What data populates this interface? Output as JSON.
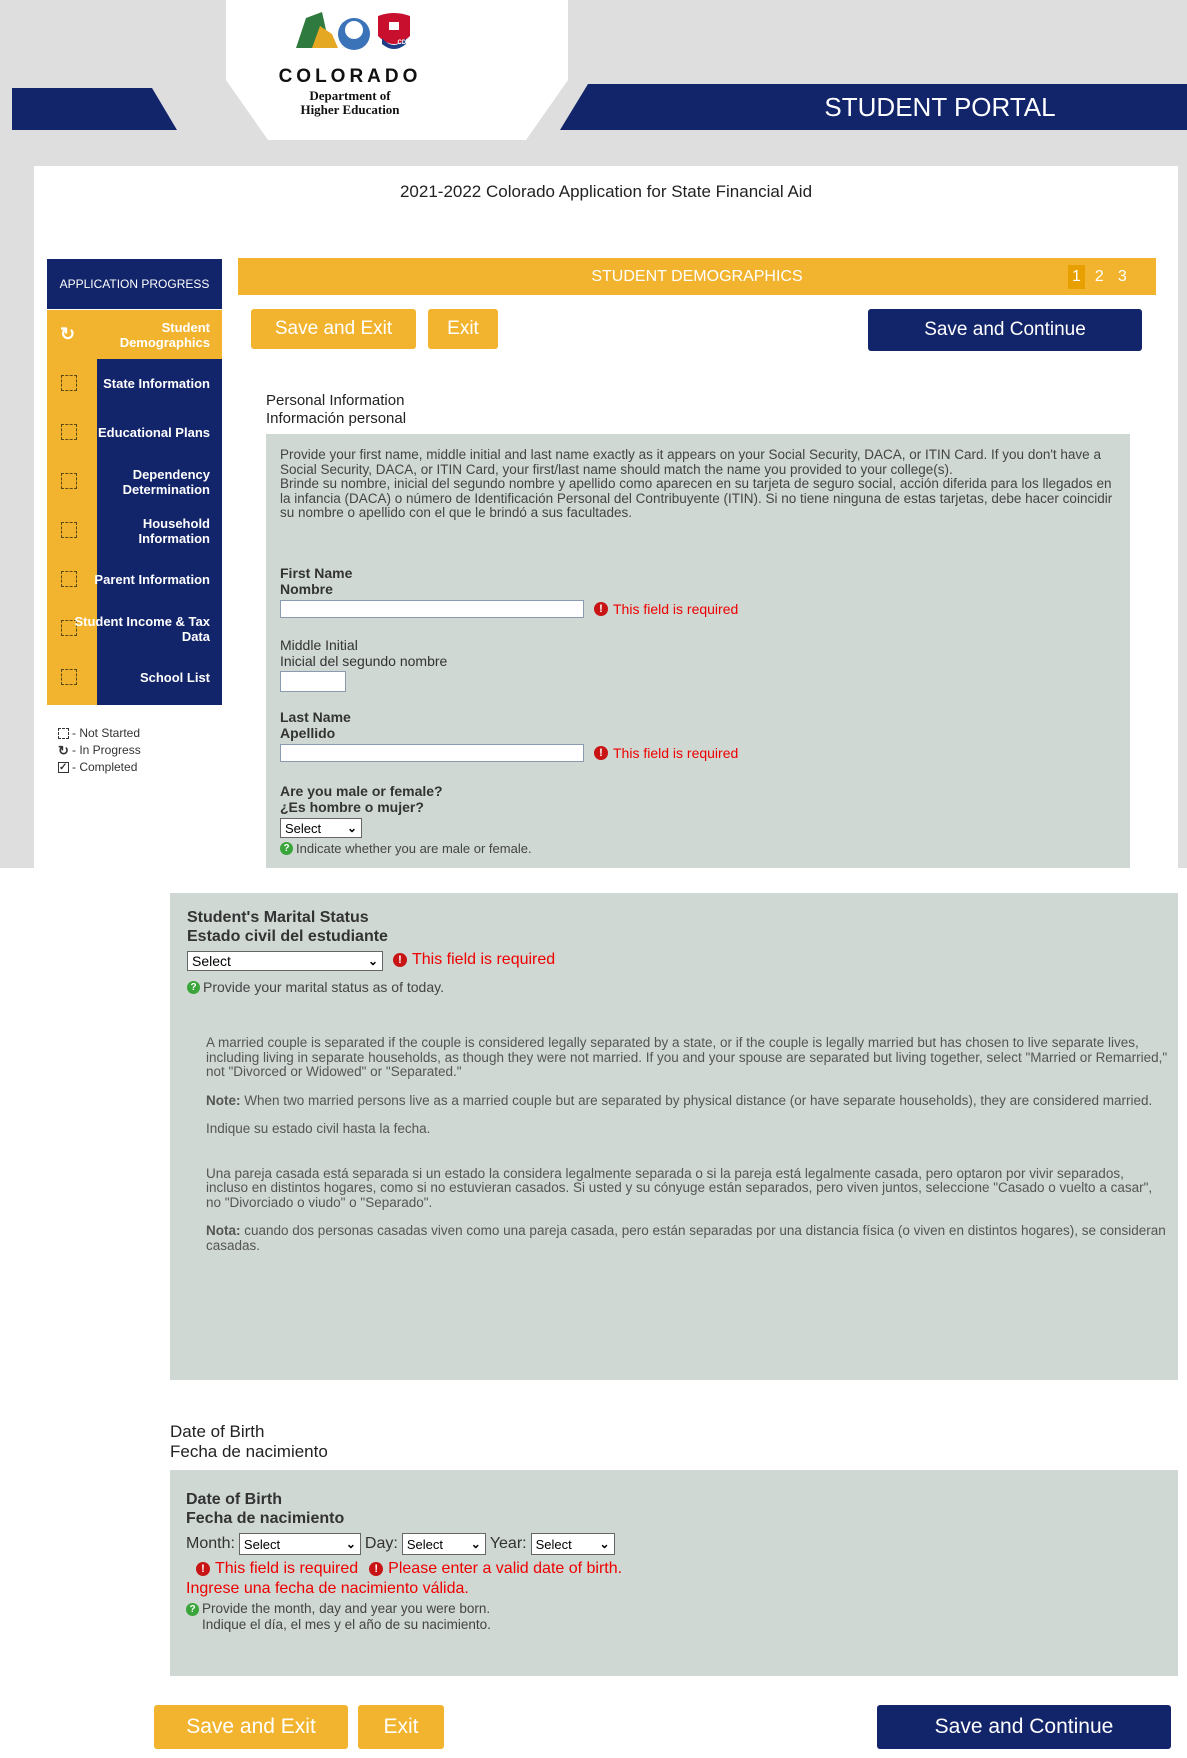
{
  "header": {
    "logo_state": "COLORADO",
    "logo_dept_line1": "Department of",
    "logo_dept_line2": "Higher Education",
    "logo_badge": "CDHE",
    "portal_title": "STUDENT PORTAL"
  },
  "app_title": "2021-2022 Colorado Application for State Financial Aid",
  "sidebar": {
    "heading": "APPLICATION PROGRESS",
    "items": [
      {
        "label": "Student Demographics",
        "status": "in-progress"
      },
      {
        "label": "State Information",
        "status": "not-started"
      },
      {
        "label": "Educational Plans",
        "status": "not-started"
      },
      {
        "label": "Dependency Determination",
        "status": "not-started"
      },
      {
        "label": "Household Information",
        "status": "not-started"
      },
      {
        "label": "Parent Information",
        "status": "not-started"
      },
      {
        "label": "Student Income & Tax Data",
        "status": "not-started"
      },
      {
        "label": "School List",
        "status": "not-started"
      }
    ],
    "legend": {
      "not_started": "- Not Started",
      "in_progress": "- In Progress",
      "completed": "- Completed"
    }
  },
  "section": {
    "title": "STUDENT DEMOGRAPHICS",
    "pages": [
      "1",
      "2",
      "3"
    ],
    "current_page": "1"
  },
  "buttons": {
    "save_exit": "Save and Exit",
    "exit": "Exit",
    "save_continue": "Save and Continue"
  },
  "personal": {
    "heading_en": "Personal Information",
    "heading_es": "Información personal",
    "instructions_en": "Provide your first name, middle initial and last name exactly as it appears on your Social Security, DACA, or ITIN Card. If you don't have a Social Security, DACA, or ITIN Card, your first/last name should match the name you provided to your college(s).",
    "instructions_es": "Brinde su nombre, inicial del segundo nombre y apellido como aparecen en su tarjeta de seguro social, acción diferida para los llegados en la infancia (DACA) o número de Identificación Personal del Contribuyente (ITIN). Si no tiene ninguna de estas tarjetas, debe hacer coincidir su nombre o apellido con el que le brindó a sus facultades.",
    "first_name_en": "First Name",
    "first_name_es": "Nombre",
    "first_name_value": "",
    "middle_initial_en": "Middle Initial",
    "middle_initial_es": "Inicial del segundo nombre",
    "middle_initial_value": "",
    "last_name_en": "Last Name",
    "last_name_es": "Apellido",
    "last_name_value": "",
    "sex_question_en": "Are you male or female?",
    "sex_question_es": "¿Es hombre o mujer?",
    "sex_selected": "Select",
    "sex_help": "Indicate whether you are male or female."
  },
  "marital": {
    "label_en": "Student's Marital Status",
    "label_es": "Estado civil del estudiante",
    "selected": "Select",
    "help": "Provide your marital status as of today.",
    "para1": "A married couple is separated if the couple is considered legally separated by a state, or if the couple is legally married but has chosen to live separate lives, including living in separate households, as though they were not married. If you and your spouse are separated but living together, select \"Married or Remarried,\" not \"Divorced or Widowed\" or \"Separated.\"",
    "note_label": "Note:",
    "note_text": " When two married persons live as a married couple but are separated by physical distance (or have separate households), they are considered married.",
    "para_es_short": "Indique su estado civil hasta la fecha.",
    "para_es": "Una pareja casada está separada si un estado la considera legalmente separada o si la pareja está legalmente casada, pero optaron por vivir separados, incluso en distintos hogares, como si no estuvieran casados. Si usted y su cónyuge están separados, pero viven juntos, seleccione \"Casado o vuelto a casar\", no \"Divorciado o viudo\" o \"Separado\".",
    "nota_label": "Nota:",
    "nota_text": " cuando dos personas casadas viven como una pareja casada, pero están separadas por una distancia física (o viven en distintos hogares), se consideran casadas."
  },
  "dob": {
    "heading_en": "Date of Birth",
    "heading_es": "Fecha de nacimiento",
    "label_en": "Date of Birth",
    "label_es": "Fecha de nacimiento",
    "month_label": "Month:",
    "day_label": "Day:",
    "year_label": "Year:",
    "month_selected": "Select",
    "day_selected": "Select",
    "year_selected": "Select",
    "err_invalid_en": "Please enter a valid date of birth.",
    "err_invalid_es": "Ingrese una fecha de nacimiento válida.",
    "help_en": "Provide the month, day and year you were born.",
    "help_es": "Indique el día, el mes y el año de su nacimiento."
  },
  "errors": {
    "required": "This field is required"
  },
  "icons": {
    "error": "exclamation-circle-icon",
    "help": "question-circle-icon",
    "in_progress": "refresh-icon",
    "not_started": "dashed-square-icon",
    "completed": "checked-square-icon"
  },
  "colors": {
    "navy": "#12246a",
    "gold": "#f2b42f",
    "panel": "#cfd8d3",
    "error": "#e00000"
  }
}
